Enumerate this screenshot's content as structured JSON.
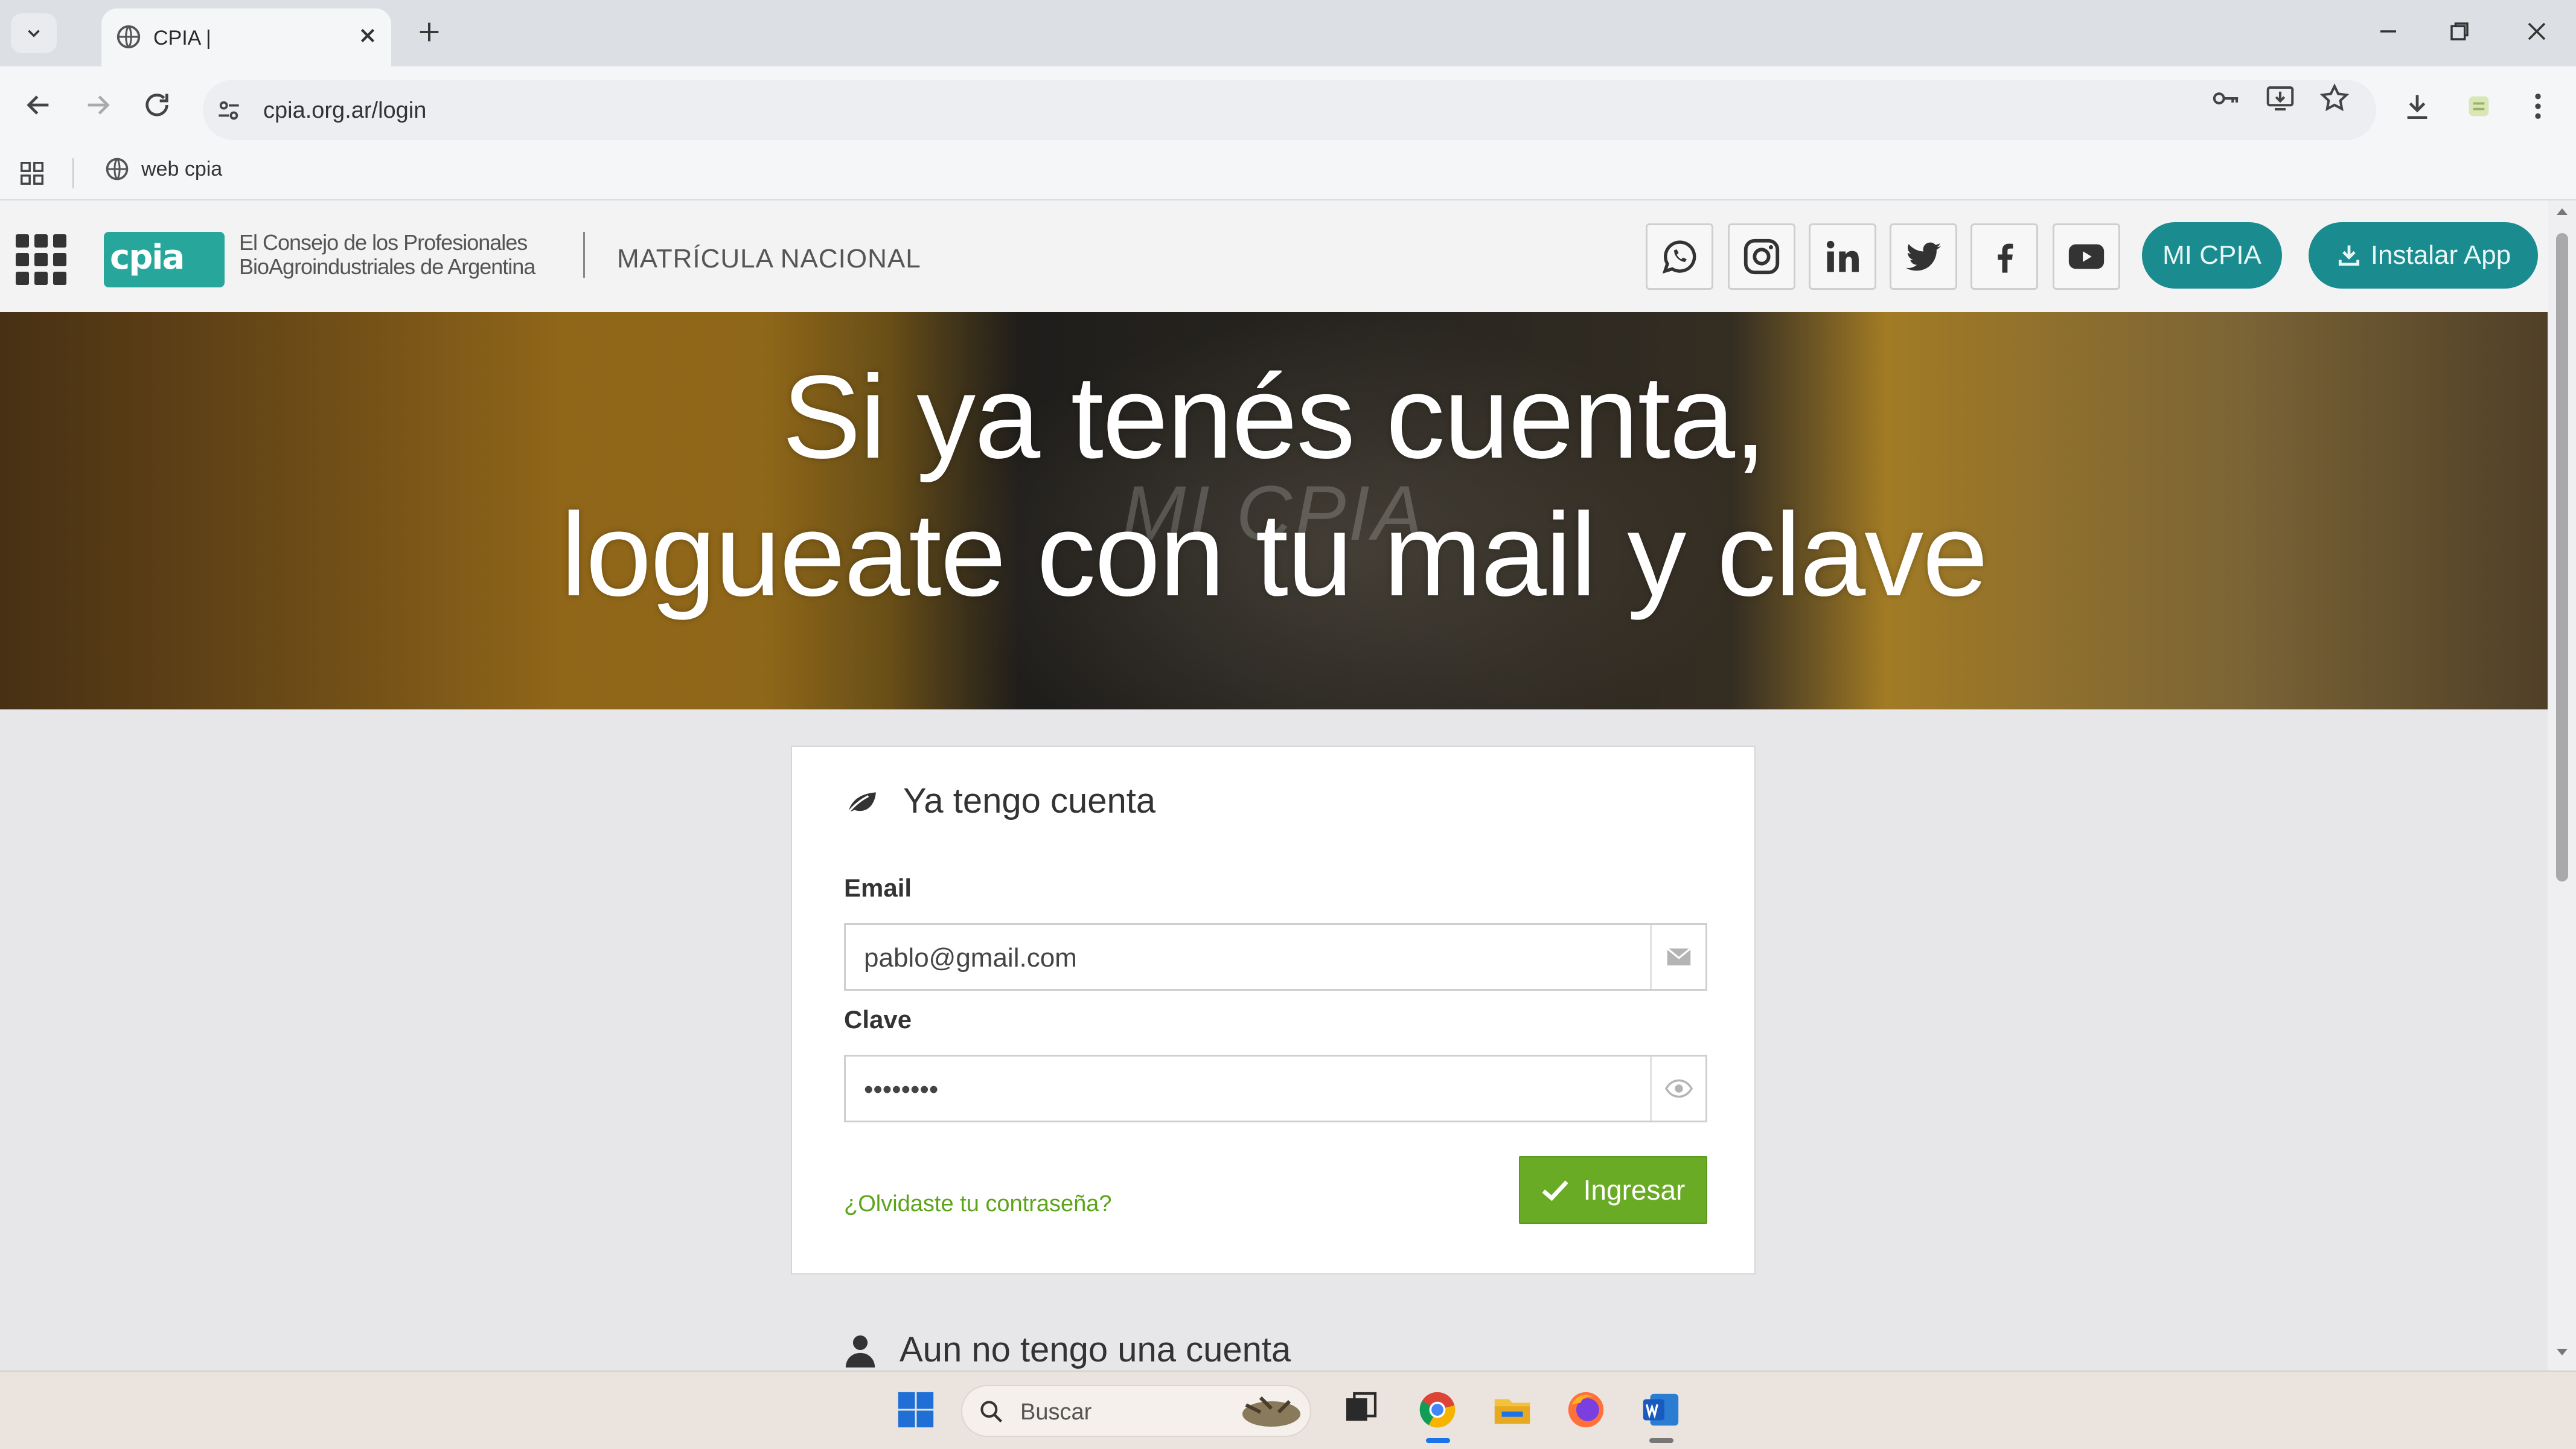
{
  "browser": {
    "tab_title": "CPIA |",
    "url": "cpia.org.ar/login",
    "bookmark": "web cpia"
  },
  "header": {
    "logo_text": "cpia",
    "org_line1": "El Consejo de los Profesionales",
    "org_line2": "BioAgroindustriales de Argentina",
    "section_title": "MATRÍCULA NACIONAL",
    "social": [
      "whatsapp-icon",
      "instagram-icon",
      "linkedin-icon",
      "twitter-icon",
      "facebook-icon",
      "youtube-icon"
    ],
    "mi_cpia_label": "MI CPIA",
    "install_label": "Instalar App",
    "accent": "#1a8b8f"
  },
  "hero": {
    "line1": "Si ya tenés cuenta,",
    "line2": "logueate con tu mail y clave",
    "watermark": "MI CPIA"
  },
  "login": {
    "title": "Ya tengo cuenta",
    "email_label": "Email",
    "email_value": "pablo@gmail.com",
    "password_label": "Clave",
    "password_value": "••••••••",
    "forgot_link": "¿Olvidaste tu contraseña?",
    "submit_label": "Ingresar",
    "button_color": "#6aab25",
    "link_color": "#5ca41a"
  },
  "register": {
    "title": "Aun no tengo una cuenta"
  },
  "taskbar": {
    "search_placeholder": "Buscar"
  }
}
